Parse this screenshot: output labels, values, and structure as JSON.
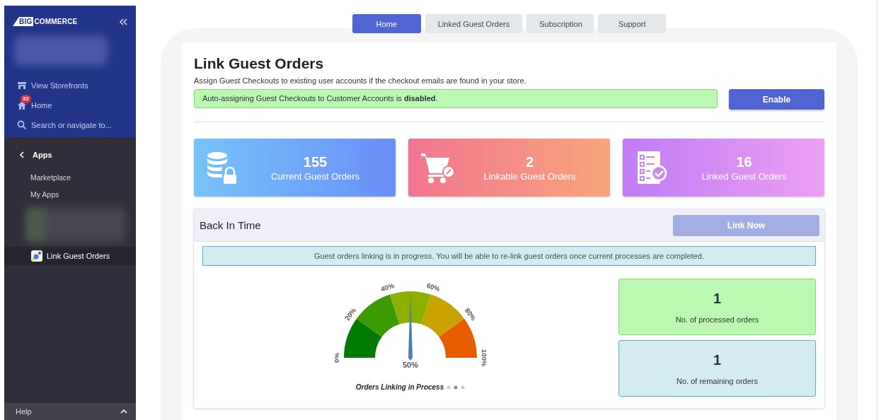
{
  "sidebar": {
    "logo": {
      "mark": "BIG",
      "word": "COMMERCE"
    },
    "nav": [
      {
        "kind": "storefront",
        "label": "View Storefronts"
      },
      {
        "kind": "home",
        "label": "Home",
        "badge": "32"
      },
      {
        "kind": "search",
        "label": "Search or navigate to..."
      }
    ],
    "section": {
      "title": "Apps"
    },
    "items": [
      {
        "label": "Marketplace",
        "selected": false
      },
      {
        "label": "My Apps",
        "selected": false
      },
      {
        "label": "Link Guest Orders",
        "selected": true,
        "kind": "app"
      }
    ],
    "footer": {
      "label": "Help"
    }
  },
  "tabs": [
    {
      "label": "Home",
      "selected": true
    },
    {
      "label": "Linked Guest Orders",
      "selected": false
    },
    {
      "label": "Subscription",
      "selected": false
    },
    {
      "label": "Support",
      "selected": false
    }
  ],
  "page": {
    "title": "Link Guest Orders",
    "subtitle": "Assign Guest Checkouts to existing user accounts if the checkout emails are found in your store.",
    "notice": "Auto-assigning Guest Checkouts to Customer Accounts is **disabled**.",
    "button": "Enable"
  },
  "stats": [
    {
      "kind": "database",
      "value": "155",
      "label": "Current Guest Orders"
    },
    {
      "kind": "cart",
      "value": "2",
      "label": "Linkable Guest Orders"
    },
    {
      "kind": "checklist",
      "value": "16",
      "label": "Linked Guest Orders"
    }
  ],
  "panel": {
    "title": "Back In Time",
    "button": {
      "label": "Link Now",
      "disabled": true
    },
    "info": "Guest orders linking is in progress. You will be able to re-link guest orders once current processes are completed.",
    "gauge": {
      "ticks": [
        "0%",
        "20%",
        "40%",
        "60%",
        "80%",
        "100%"
      ],
      "level": 0.5,
      "reading": "50%",
      "caption": "Orders Linking in Process"
    },
    "counters": [
      {
        "kind": "processed",
        "value": "1",
        "label": "No. of processed orders"
      },
      {
        "kind": "remaining",
        "value": "1",
        "label": "No. of remaining orders"
      }
    ]
  }
}
